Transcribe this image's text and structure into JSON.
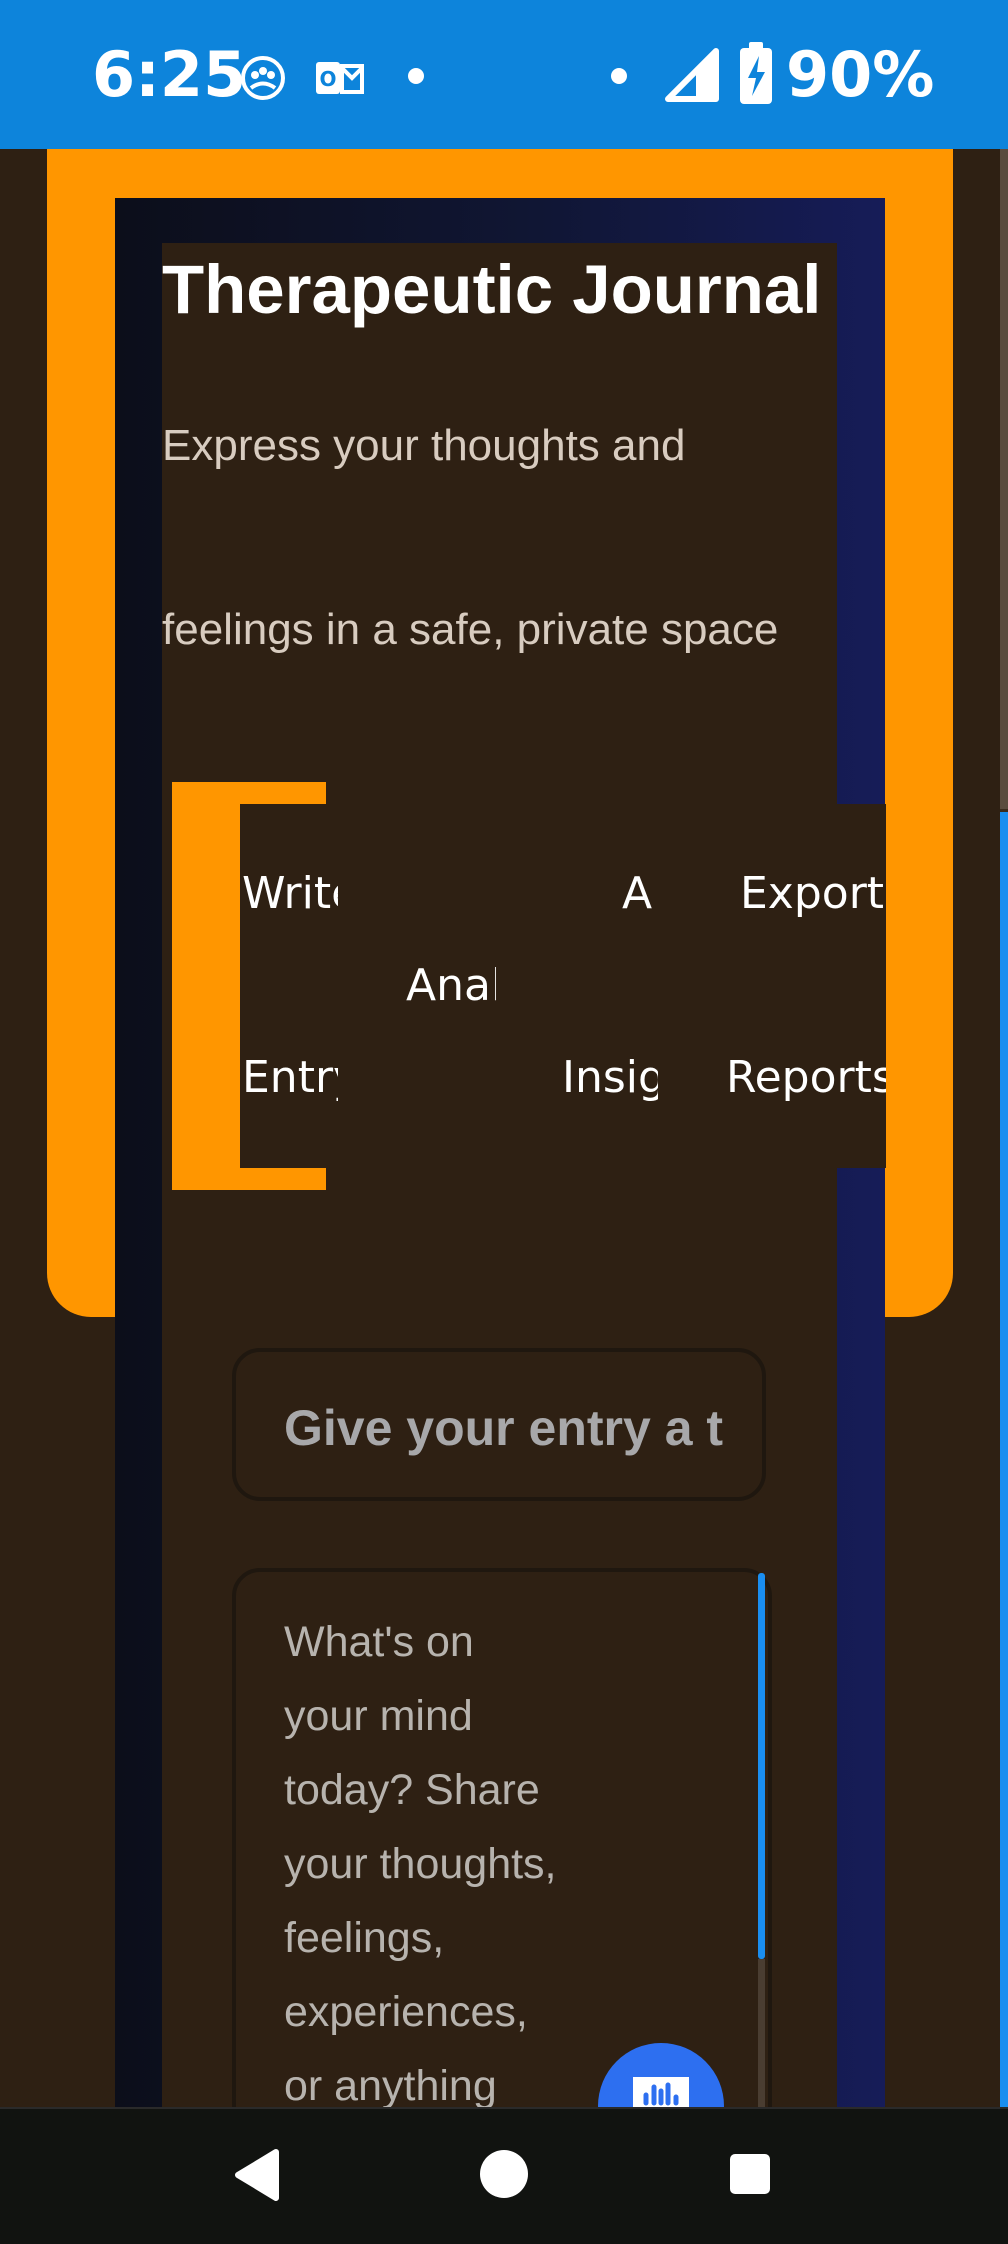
{
  "status_bar": {
    "time": "6:25",
    "battery": "90%",
    "icons": [
      "app-notification-icon",
      "outlook-icon",
      "dot-icon",
      "dot-icon",
      "signal-icon",
      "battery-charging-icon"
    ]
  },
  "header": {
    "title": "Therapeutic Journal",
    "subtitle_line1": "Express your thoughts and",
    "subtitle_line2": "feelings in a safe, private space"
  },
  "tabs": {
    "write": {
      "line1": "Write",
      "line2": "Entry"
    },
    "analysis": {
      "line1": "Anal"
    },
    "ai_insights": {
      "line1": "AI",
      "line2": "Insig"
    },
    "export": {
      "line1": "Export",
      "line2": "Reports"
    }
  },
  "form": {
    "title_placeholder": "Give your entry a tit",
    "body_placeholder_lines": [
      "What's on",
      "your mind",
      "today? Share",
      "your thoughts,",
      "feelings,",
      "experiences,",
      "or anything"
    ]
  },
  "nav": {
    "back": "back-icon",
    "home": "home-icon",
    "recents": "recents-icon"
  },
  "colors": {
    "status_bar": "#0d84db",
    "background": "#2e2013",
    "accent_orange": "#ff9600",
    "panel_blue": "#161c58",
    "mic_blue": "#2d6ff0"
  }
}
